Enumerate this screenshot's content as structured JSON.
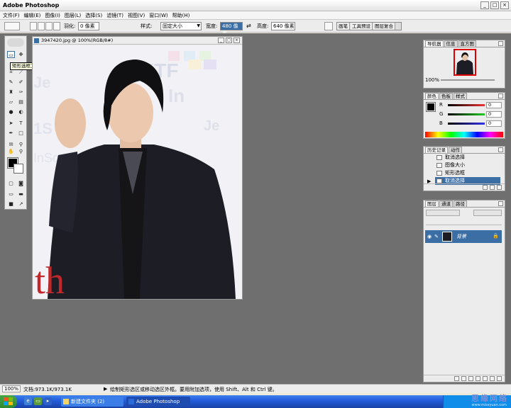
{
  "app": {
    "title": "Adobe Photoshop"
  },
  "menu": [
    "文件(F)",
    "编辑(E)",
    "图像(I)",
    "图层(L)",
    "选择(S)",
    "滤镜(T)",
    "视图(V)",
    "窗口(W)",
    "帮助(H)"
  ],
  "options": {
    "feather_label": "羽化:",
    "feather_value": "0 像素",
    "style_label": "样式:",
    "style_value": "固定大小",
    "width_label": "宽度:",
    "width_value": "480 像素",
    "height_label": "高度:",
    "height_value": "640 像素",
    "palette_well": [
      "画笔",
      "工具预设",
      "图层复合"
    ]
  },
  "toolbox": {
    "tooltip": "矩形选框工具 (M)"
  },
  "document": {
    "title": "3947420.jpg @ 100%(RGB/8#)",
    "photo_text": "th"
  },
  "navigator": {
    "tabs": [
      "导航器",
      "信息",
      "直方图"
    ],
    "zoom": "100%"
  },
  "color_panel": {
    "tabs": [
      "颜色",
      "色板",
      "样式"
    ],
    "channels": [
      {
        "label": "R",
        "value": "0",
        "color": "#d33"
      },
      {
        "label": "G",
        "value": "0",
        "color": "#2a2"
      },
      {
        "label": "B",
        "value": "0",
        "color": "#33c"
      }
    ]
  },
  "history_panel": {
    "tabs": [
      "历史记录",
      "动作"
    ],
    "items": [
      "取消选择",
      "图像大小",
      "矩形选框",
      "取消选择"
    ],
    "selected_index": 3
  },
  "layers_panel": {
    "tabs": [
      "图层",
      "通道",
      "路径"
    ],
    "layer_name": "背景"
  },
  "status": {
    "zoom": "100%",
    "doc": "文档:973.1K/973.1K",
    "hint": "绘制矩形选区或移动选区外框。要用附加选项，使用 Shift、Alt 和 Ctrl 键。"
  },
  "taskbar": {
    "tasks": [
      "新建文件夹 (2)",
      "Adobe Photoshop"
    ],
    "watermark": "思缘网络",
    "watermark_url": "www.missyuan.com"
  },
  "colors": {
    "accent": "#3a6ea5",
    "workspace": "#6f6f6f",
    "taskbar": "#245edc"
  }
}
